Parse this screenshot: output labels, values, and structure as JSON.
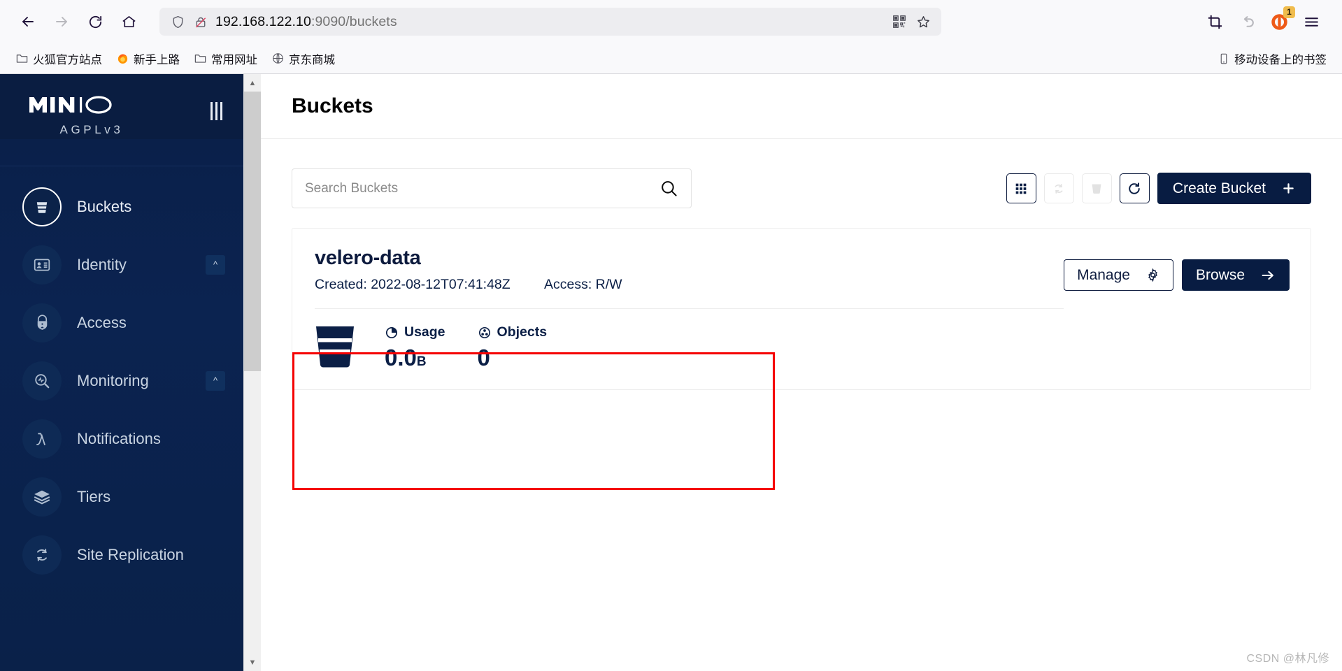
{
  "browser": {
    "nav": {
      "back_icon": "arrow-left-icon",
      "forward_icon": "arrow-right-icon",
      "reload_icon": "reload-icon",
      "home_icon": "home-icon"
    },
    "url": {
      "host": "192.168.122.10",
      "rest": ":9090/buckets",
      "shield_icon": "shield-icon",
      "insecure_icon": "broken-lock-icon",
      "qr_icon": "qr-code-icon",
      "bookmark_icon": "star-icon"
    },
    "toolbar": {
      "screenshot_icon": "crop-screenshot-icon",
      "undo_icon": "undo-arrow-icon",
      "pocket_icon": "pocket-icon",
      "pocket_badge": "1",
      "menu_icon": "hamburger-menu-icon"
    },
    "bookmarks": [
      {
        "label": "火狐官方站点",
        "icon": "folder-icon"
      },
      {
        "label": "新手上路",
        "icon": "firefox-icon"
      },
      {
        "label": "常用网址",
        "icon": "folder-icon"
      },
      {
        "label": "京东商城",
        "icon": "globe-icon"
      }
    ],
    "mobile_bookmarks": {
      "label": "移动设备上的书签",
      "icon": "mobile-device-icon"
    }
  },
  "sidebar": {
    "logo": "MINIO",
    "license": "AGPLv3",
    "collapse_icon": "menu-columns-icon",
    "items": [
      {
        "label": "Buckets",
        "icon": "bucket-icon",
        "active": true,
        "expandable": false
      },
      {
        "label": "Identity",
        "icon": "id-card-icon",
        "active": false,
        "expandable": true
      },
      {
        "label": "Access",
        "icon": "lock-person-icon",
        "active": false,
        "expandable": false
      },
      {
        "label": "Monitoring",
        "icon": "magnifier-pulse-icon",
        "active": false,
        "expandable": true
      },
      {
        "label": "Notifications",
        "icon": "lambda-icon",
        "active": false,
        "expandable": false
      },
      {
        "label": "Tiers",
        "icon": "layers-icon",
        "active": false,
        "expandable": false
      },
      {
        "label": "Site Replication",
        "icon": "replication-icon",
        "active": false,
        "expandable": false
      }
    ]
  },
  "header": {
    "title": "Buckets"
  },
  "search": {
    "placeholder": "Search Buckets",
    "value": "",
    "icon": "search-icon"
  },
  "toolbar": {
    "grid_view_icon": "grid-view-icon",
    "sync_icon": "sync-buckets-icon",
    "delete_icon": "delete-bucket-icon",
    "refresh_icon": "refresh-icon",
    "create_label": "Create Bucket",
    "create_icon": "plus-icon"
  },
  "buckets": [
    {
      "name": "velero-data",
      "created_label": "Created: 2022-08-12T07:41:48Z",
      "access_label": "Access: R/W",
      "usage_label": "Usage",
      "usage_icon": "pie-chart-icon",
      "usage_value": "0.0",
      "usage_unit": "B",
      "objects_label": "Objects",
      "objects_icon": "objects-icon",
      "objects_value": "0",
      "manage_label": "Manage",
      "manage_icon": "gear-icon",
      "browse_label": "Browse",
      "browse_icon": "arrow-right-icon",
      "bucket_glyph": "bucket-icon"
    }
  ],
  "annotation": {
    "color": "#f50000"
  },
  "watermark": {
    "text": "CSDN @林凡修"
  },
  "colors": {
    "brand_navy": "#081c42",
    "sidebar_bg": "#0a2149",
    "accent_red": "#f50000"
  }
}
